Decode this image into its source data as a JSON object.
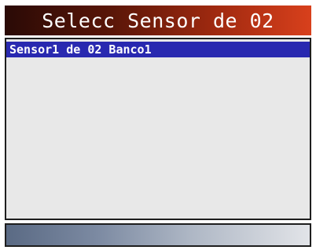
{
  "screen": {
    "title": "Selecc Sensor de 02",
    "list": {
      "items": [
        {
          "label": "Sensor1 de 02 Banco1",
          "selected": true
        }
      ]
    }
  },
  "colors": {
    "title_gradient": [
      "#2a0a06",
      "#d8401c"
    ],
    "selection": "#2929b0",
    "list_background": "#e8e8e8",
    "status_gradient": [
      "#5a6a84",
      "#e2e4e8"
    ]
  }
}
